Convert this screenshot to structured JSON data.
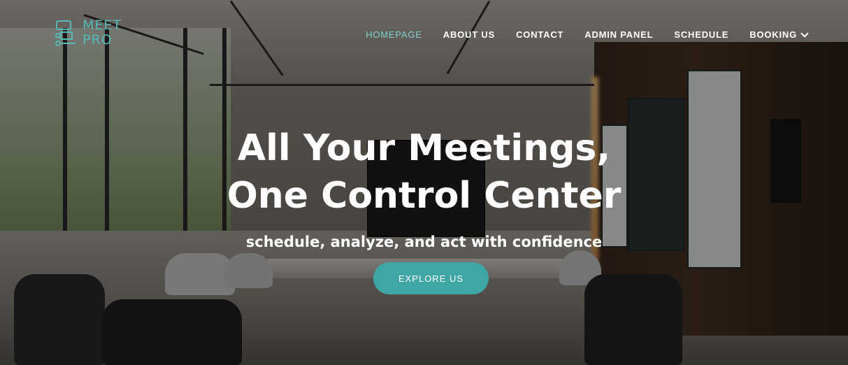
{
  "brand": {
    "logo_line1": "MEET",
    "logo_line2": "PRO",
    "accent_color": "#3ea7a5",
    "logo_icon": "meeting-table-icon"
  },
  "nav": {
    "items": [
      {
        "label": "HOMEPAGE",
        "active": true
      },
      {
        "label": "ABOUT US",
        "active": false
      },
      {
        "label": "CONTACT",
        "active": false
      },
      {
        "label": "ADMIN PANEL",
        "active": false
      },
      {
        "label": "SCHEDULE",
        "active": false
      },
      {
        "label": "BOOKING",
        "active": false,
        "dropdown_icon": "chevron-down-icon"
      }
    ]
  },
  "hero": {
    "headline_line1": "All Your Meetings,",
    "headline_line2": "One Control Center",
    "subheadline": "schedule, analyze, and act with confidence",
    "cta_label": "EXPLORE US"
  }
}
